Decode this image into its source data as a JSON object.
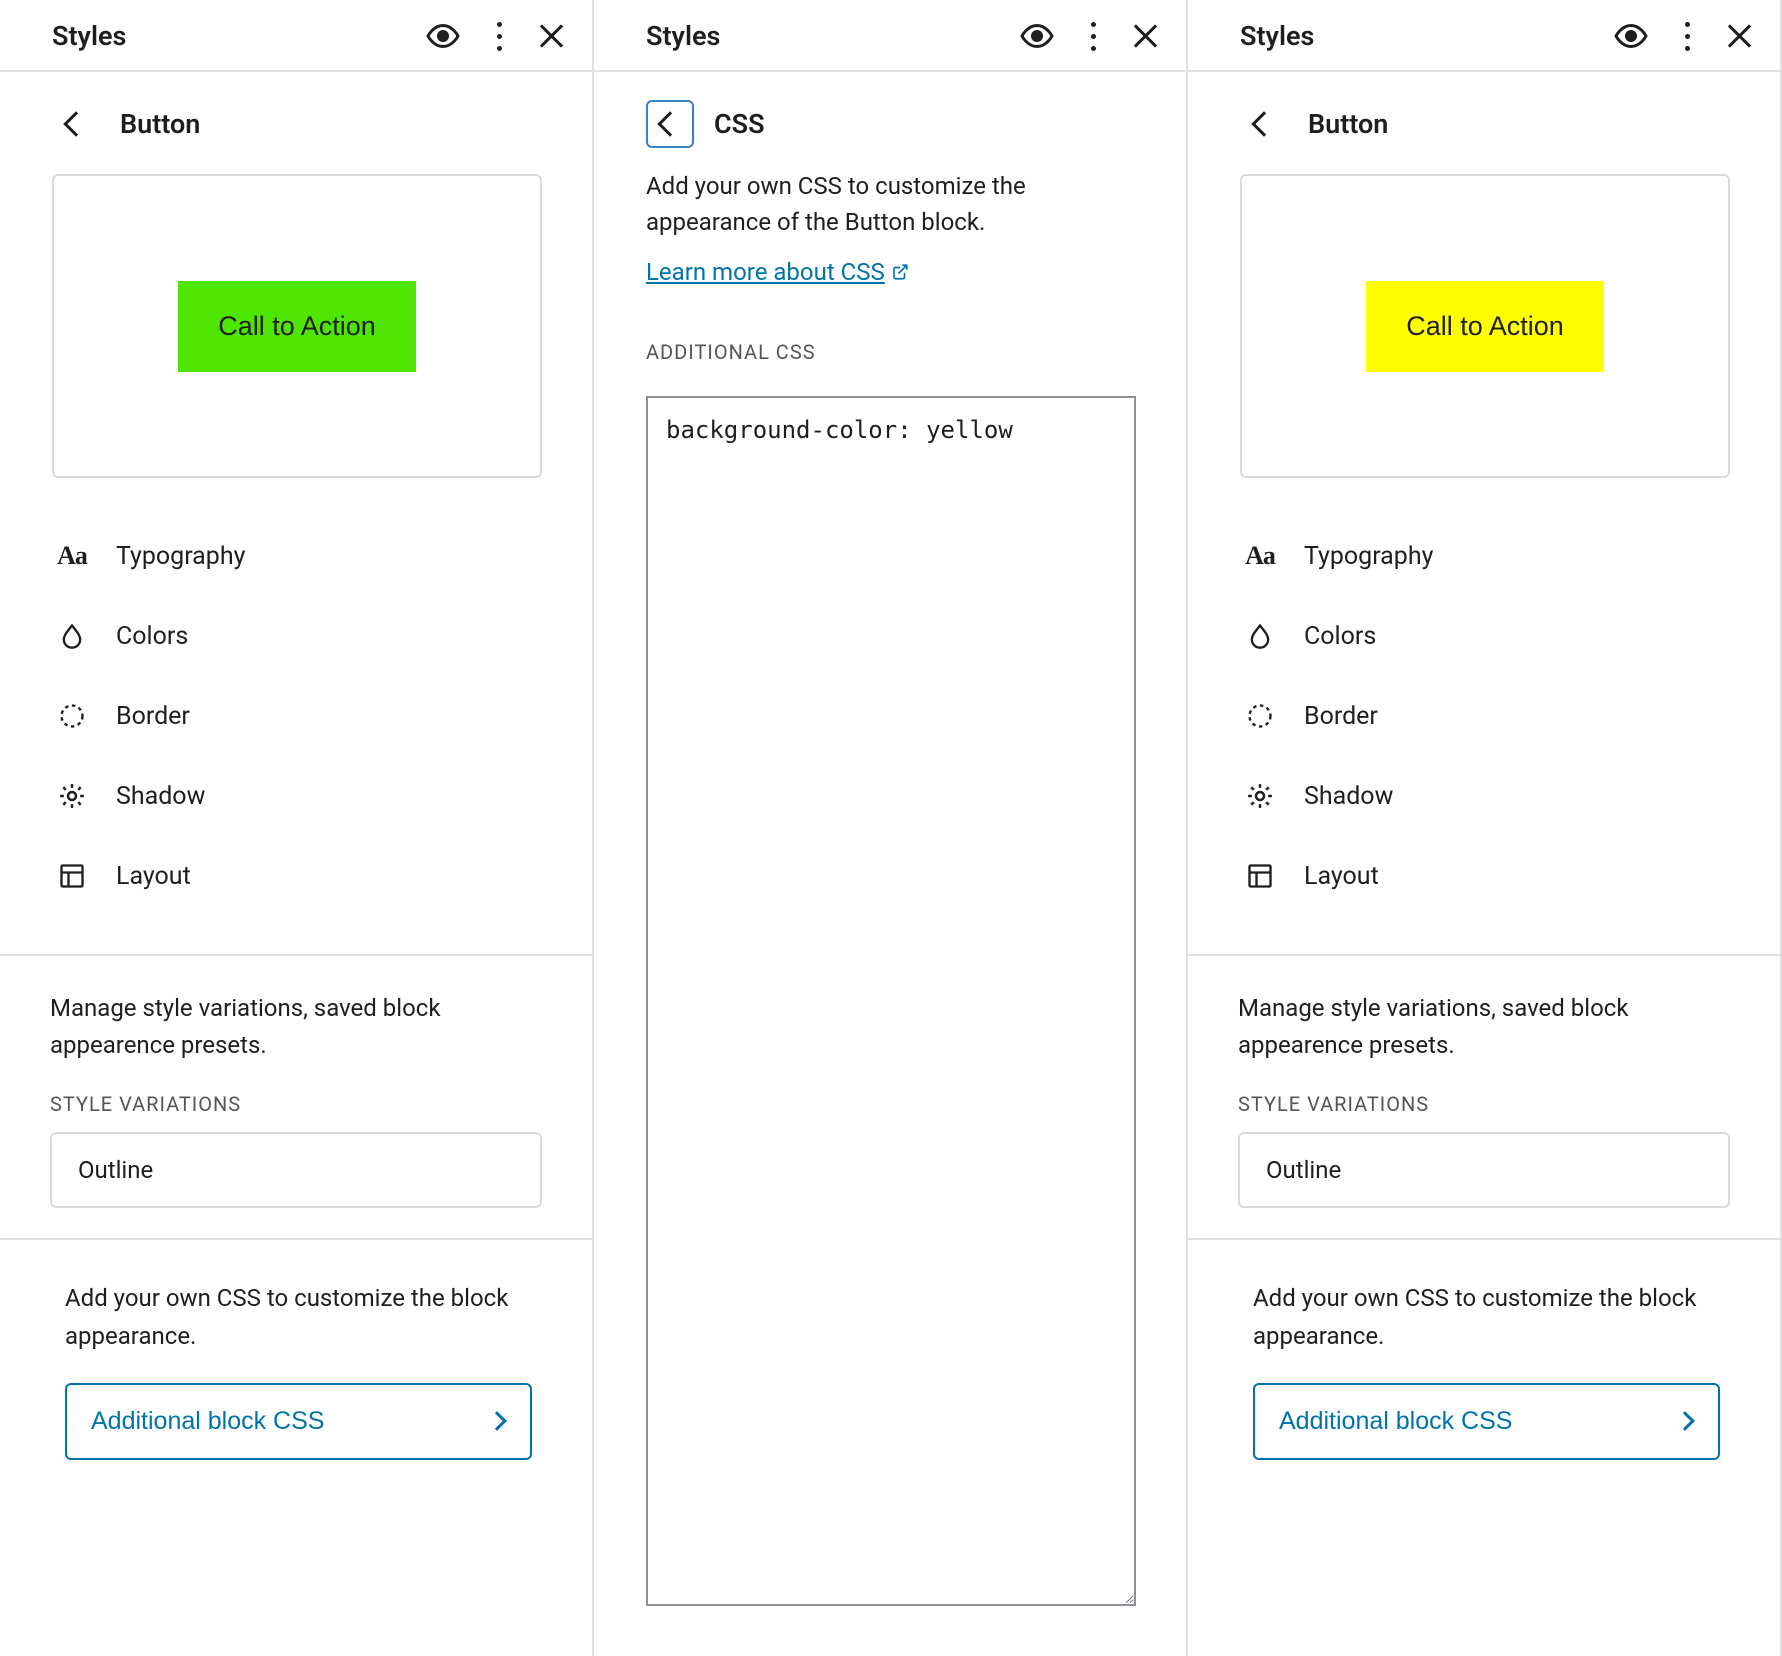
{
  "header": {
    "title": "Styles"
  },
  "left": {
    "section_title": "Button",
    "cta_label": "Call to Action",
    "cta_color": "#4ee600",
    "items": {
      "typography": "Typography",
      "colors": "Colors",
      "border": "Border",
      "shadow": "Shadow",
      "layout": "Layout"
    },
    "variations_desc": "Manage style variations, saved block appearence presets.",
    "variations_label": "Style Variations",
    "variation_option": "Outline",
    "css_desc": "Add your own CSS to customize the block appearance.",
    "css_button": "Additional block CSS"
  },
  "center": {
    "section_title": "CSS",
    "desc": "Add your own CSS to customize the appearance of the Button block.",
    "learn_more": "Learn more about CSS",
    "textarea_label": "Additional CSS",
    "textarea_value": "background-color: yellow"
  },
  "right": {
    "section_title": "Button",
    "cta_label": "Call to Action",
    "cta_color": "#ffff00",
    "items": {
      "typography": "Typography",
      "colors": "Colors",
      "border": "Border",
      "shadow": "Shadow",
      "layout": "Layout"
    },
    "variations_desc": "Manage style variations, saved block appearence presets.",
    "variations_label": "Style Variations",
    "variation_option": "Outline",
    "css_desc": "Add your own CSS to customize the block appearance.",
    "css_button": "Additional block CSS"
  }
}
